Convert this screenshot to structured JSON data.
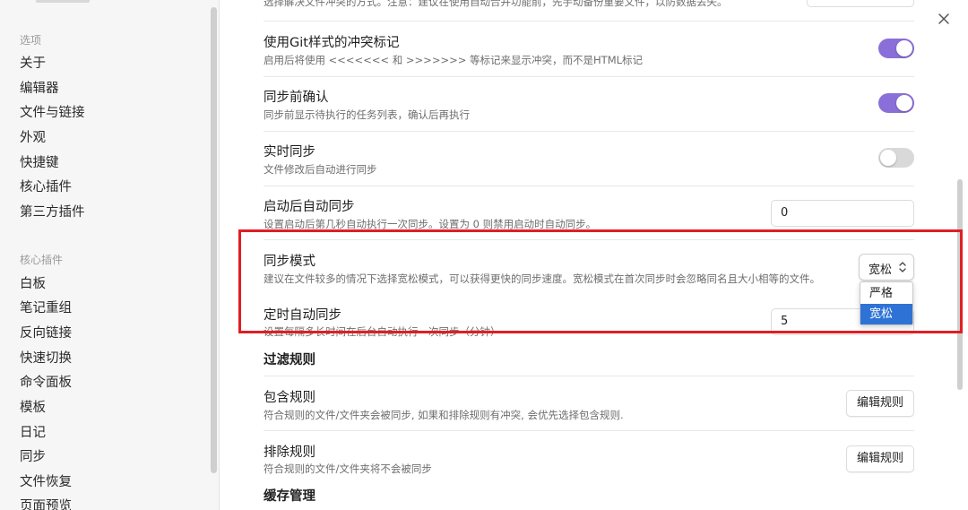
{
  "sidebar": {
    "options_header": "选项",
    "options_items": [
      "关于",
      "编辑器",
      "文件与链接",
      "外观",
      "快捷键",
      "核心插件",
      "第三方插件"
    ],
    "core_header": "核心插件",
    "core_items": [
      "白板",
      "笔记重组",
      "反向链接",
      "快速切换",
      "命令面板",
      "模板",
      "日记",
      "同步",
      "文件恢复",
      "页面预览"
    ]
  },
  "partial_top": {
    "desc": "选择解决文件冲突的方式。注意：建议在使用自动合并功能前，先手动备份重要文件，以防数据丢失。"
  },
  "settings": {
    "git_markers": {
      "title": "使用Git样式的冲突标记",
      "desc": "启用后将使用 <<<<<<< 和 >>>>>>> 等标记来显示冲突，而不是HTML标记",
      "state": "on"
    },
    "confirm_before_sync": {
      "title": "同步前确认",
      "desc": "同步前显示待执行的任务列表，确认后再执行",
      "state": "on"
    },
    "realtime_sync": {
      "title": "实时同步",
      "desc": "文件修改后自动进行同步",
      "state": "off"
    },
    "startup_sync": {
      "title": "启动后自动同步",
      "desc": "设置启动后第几秒自动执行一次同步。设置为 0 则禁用启动时自动同步。",
      "value": "0"
    },
    "sync_mode": {
      "title": "同步模式",
      "desc": "建议在文件较多的情况下选择宽松模式，可以获得更快的同步速度。宽松模式在首次同步时会忽略同名且大小相等的文件。",
      "selected": "宽松",
      "options": [
        "严格",
        "宽松"
      ]
    },
    "timed_sync": {
      "title": "定时自动同步",
      "desc": "设置每隔多长时间在后台自动执行一次同步（分钟）",
      "value": "5"
    }
  },
  "filter": {
    "header": "过滤规则",
    "include": {
      "title": "包含规则",
      "desc": "符合规则的文件/文件夹会被同步, 如果和排除规则有冲突, 会优先选择包含规则.",
      "button": "编辑规则"
    },
    "exclude": {
      "title": "排除规则",
      "desc": "符合规则的文件/文件夹将不会被同步",
      "button": "编辑规则"
    }
  },
  "cache": {
    "header": "缓存管理"
  },
  "colors": {
    "accent": "#8b6fd8",
    "selected_option": "#2f72d6",
    "highlight_box": "#e01e23"
  }
}
